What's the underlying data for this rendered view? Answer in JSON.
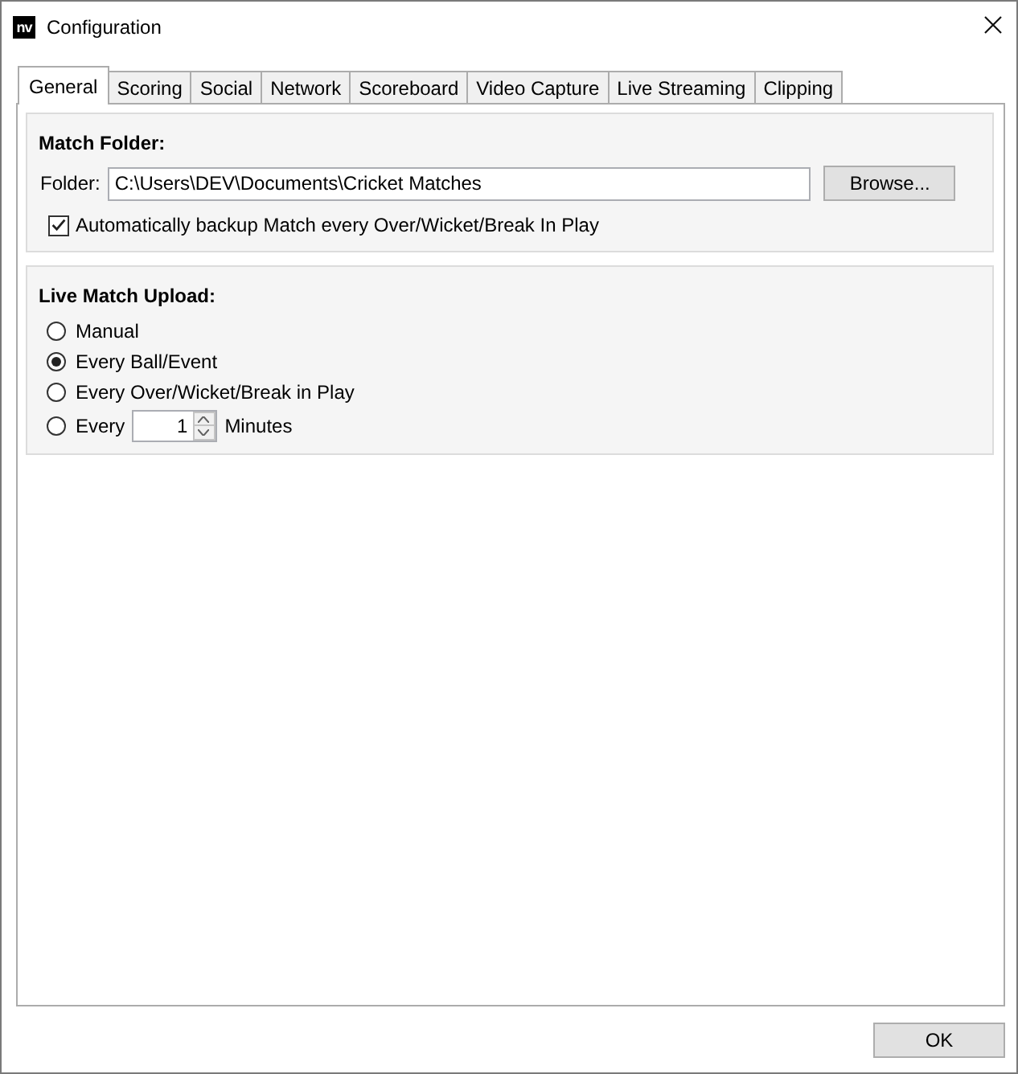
{
  "window": {
    "logo": "nv",
    "title": "Configuration"
  },
  "tabs": [
    {
      "label": "General",
      "selected": true
    },
    {
      "label": "Scoring",
      "selected": false
    },
    {
      "label": "Social",
      "selected": false
    },
    {
      "label": "Network",
      "selected": false
    },
    {
      "label": "Scoreboard",
      "selected": false
    },
    {
      "label": "Video Capture",
      "selected": false
    },
    {
      "label": "Live Streaming",
      "selected": false
    },
    {
      "label": "Clipping",
      "selected": false
    }
  ],
  "match_folder": {
    "title": "Match Folder:",
    "folder_label": "Folder:",
    "folder_path": "C:\\Users\\DEV\\Documents\\Cricket Matches",
    "browse_button": "Browse...",
    "backup": {
      "label": "Automatically backup Match every Over/Wicket/Break In Play",
      "checked": true
    }
  },
  "live_match_upload": {
    "title": "Live Match Upload:",
    "options": [
      {
        "kind": "plain",
        "label": "Manual",
        "selected": false
      },
      {
        "kind": "plain",
        "label": "Every Ball/Event",
        "selected": true
      },
      {
        "kind": "plain",
        "label": "Every Over/Wicket/Break in Play",
        "selected": false
      },
      {
        "kind": "interval",
        "label": "Every",
        "value": "1",
        "unit": "Minutes",
        "selected": false
      }
    ]
  },
  "buttons": [
    "OK"
  ]
}
